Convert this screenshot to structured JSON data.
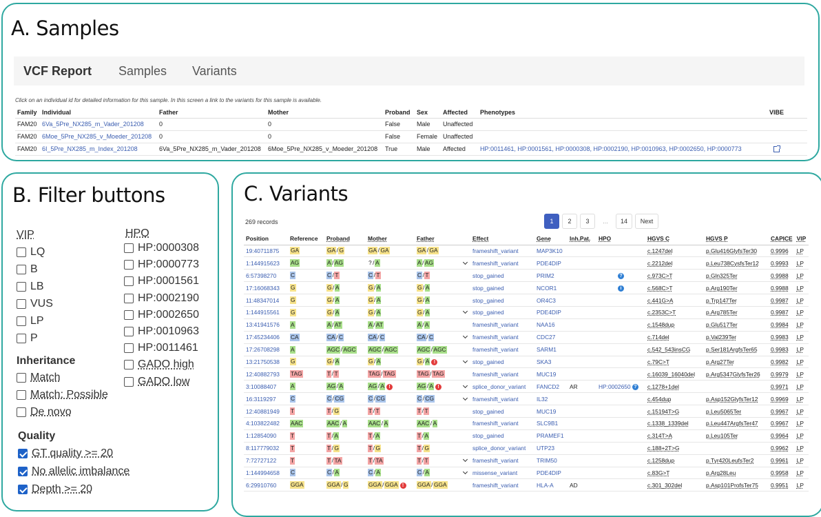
{
  "panels": {
    "a_title": "A.  Samples",
    "b_title": "B. Filter buttons",
    "c_title": "C. Variants"
  },
  "nav": {
    "brand": "VCF Report",
    "links": [
      "Samples",
      "Variants"
    ]
  },
  "samples": {
    "hint": "Click on an individual id for detailed information for this sample. In this screen a link to the variants for this sample is available.",
    "columns": [
      "Family",
      "Individual",
      "Father",
      "Mother",
      "Proband",
      "Sex",
      "Affected",
      "Phenotypes",
      "VIBE"
    ],
    "rows": [
      {
        "family": "FAM20",
        "individual": "6Va_5Pre_NX285_m_Vader_201208",
        "father": "0",
        "mother": "0",
        "proband": "False",
        "sex": "Male",
        "affected": "Unaffected",
        "phenotypes": ""
      },
      {
        "family": "FAM20",
        "individual": "6Moe_5Pre_NX285_v_Moeder_201208",
        "father": "0",
        "mother": "0",
        "proband": "False",
        "sex": "Female",
        "affected": "Unaffected",
        "phenotypes": ""
      },
      {
        "family": "FAM20",
        "individual": "6I_5Pre_NX285_m_Index_201208",
        "father": "6Va_5Pre_NX285_m_Vader_201208",
        "mother": "6Moe_5Pre_NX285_v_Moeder_201208",
        "proband": "True",
        "sex": "Male",
        "affected": "Affected",
        "phenotypes": "HP:0011461, HP:0001561, HP:0000308, HP:0002190, HP:0010963, HP:0002650, HP:0000773"
      }
    ]
  },
  "filters": {
    "vip_label": "VIP",
    "vip": [
      "LQ",
      "B",
      "LB",
      "VUS",
      "LP",
      "P"
    ],
    "hpo_label": "HPO",
    "hpo": [
      "HP:0000308",
      "HP:0000773",
      "HP:0001561",
      "HP:0002190",
      "HP:0002650",
      "HP:0010963",
      "HP:0011461",
      "GADO high",
      "GADO low"
    ],
    "inheritance_label": "Inheritance",
    "inheritance": [
      "Match",
      "Match: Possible",
      "De novo"
    ],
    "quality_label": "Quality",
    "quality": [
      "GT quality >= 20",
      "No allelic imbalance",
      "Depth >= 20"
    ]
  },
  "variants": {
    "records": "269 records",
    "pages": [
      "1",
      "2",
      "3",
      "...",
      "14",
      "Next"
    ],
    "columns": [
      "Position",
      "Reference",
      "Proband",
      "Mother",
      "Father",
      "",
      "Effect",
      "Gene",
      "Inh.Pat.",
      "HPO",
      "HGVS C",
      "HGVS P",
      "CAPICE",
      "VIP"
    ],
    "rows": [
      {
        "pos": "19:40711875",
        "ref": "GA",
        "pro": "GA/G",
        "mot": "GA/GA",
        "fat": "GA/GA",
        "eff": "frameshift_variant",
        "gene": "MAP3K10",
        "inh": "",
        "hpo": "",
        "c": "c.1247del",
        "p": "p.Glu416GlyfsTer30",
        "cap": "0.9996",
        "vip": "LP"
      },
      {
        "pos": "1:144915623",
        "ref": "AG",
        "pro": "A/AG",
        "mot": "?/A",
        "fat": "A/AG",
        "chev": true,
        "eff": "frameshift_variant",
        "gene": "PDE4DIP",
        "inh": "",
        "hpo": "",
        "c": "c.2212del",
        "p": "p.Leu738CysfsTer12",
        "cap": "0.9993",
        "vip": "LP"
      },
      {
        "pos": "6:57398270",
        "ref": "C",
        "pro": "C/T",
        "mot": "C/T",
        "fat": "C/T",
        "eff": "stop_gained",
        "gene": "PRIM2",
        "inh": "",
        "hpo": "?",
        "c": "c.973C>T",
        "p": "p.Gln325Ter",
        "cap": "0.9988",
        "vip": "LP"
      },
      {
        "pos": "17:16068343",
        "ref": "G",
        "pro": "G/A",
        "mot": "G/A",
        "fat": "G/A",
        "eff": "stop_gained",
        "gene": "NCOR1",
        "inh": "",
        "hpo": "i",
        "c": "c.568C>T",
        "p": "p.Arg190Ter",
        "cap": "0.9988",
        "vip": "LP"
      },
      {
        "pos": "11:48347014",
        "ref": "G",
        "pro": "G/A",
        "mot": "G/A",
        "fat": "G/A",
        "eff": "stop_gained",
        "gene": "OR4C3",
        "inh": "",
        "hpo": "",
        "c": "c.441G>A",
        "p": "p.Trp147Ter",
        "cap": "0.9987",
        "vip": "LP"
      },
      {
        "pos": "1:144915561",
        "ref": "G",
        "pro": "G/A",
        "mot": "G/A",
        "fat": "G/A",
        "chev": true,
        "eff": "stop_gained",
        "gene": "PDE4DIP",
        "inh": "",
        "hpo": "",
        "c": "c.2353C>T",
        "p": "p.Arg785Ter",
        "cap": "0.9987",
        "vip": "LP"
      },
      {
        "pos": "13:41941576",
        "ref": "A",
        "pro": "A/AT",
        "mot": "A/AT",
        "fat": "A/A",
        "eff": "frameshift_variant",
        "gene": "NAA16",
        "inh": "",
        "hpo": "",
        "c": "c.1548dup",
        "p": "p.Glu517Ter",
        "cap": "0.9984",
        "vip": "LP"
      },
      {
        "pos": "17:45234406",
        "ref": "CA",
        "pro": "CA/C",
        "mot": "CA/C",
        "fat": "CA/C",
        "chev": true,
        "eff": "frameshift_variant",
        "gene": "CDC27",
        "inh": "",
        "hpo": "",
        "c": "c.714del",
        "p": "p.Val239Ter",
        "cap": "0.9983",
        "vip": "LP"
      },
      {
        "pos": "17:26708298",
        "ref": "A",
        "pro": "AGC/AGC",
        "mot": "AGC/AGC",
        "fat": "AGC/AGC",
        "eff": "frameshift_variant",
        "gene": "SARM1",
        "inh": "",
        "hpo": "",
        "c": "c.542_543insCG",
        "p": "p.Ser181ArgfsTer65",
        "cap": "0.9983",
        "vip": "LP"
      },
      {
        "pos": "13:21750538",
        "ref": "G",
        "pro": "G/A",
        "mot": "G/A",
        "fat": "G/A",
        "fatX": true,
        "chev": true,
        "eff": "stop_gained",
        "gene": "SKA3",
        "inh": "",
        "hpo": "",
        "c": "c.79C>T",
        "p": "p.Arg27Ter",
        "cap": "0.9982",
        "vip": "LP"
      },
      {
        "pos": "12:40882793",
        "ref": "TAG",
        "pro": "T/T",
        "mot": "TAG/TAG",
        "fat": "TAG/TAG",
        "eff": "frameshift_variant",
        "gene": "MUC19",
        "inh": "",
        "hpo": "",
        "c": "c.16039_16040del",
        "p": "p.Arg5347GlyfsTer26",
        "cap": "0.9979",
        "vip": "LP"
      },
      {
        "pos": "3:10088407",
        "ref": "A",
        "pro": "AG/A",
        "mot": "AG/A",
        "motX": true,
        "fat": "AG/A",
        "fatX": true,
        "chev": true,
        "eff": "splice_donor_variant",
        "gene": "FANCD2",
        "inh": "AR",
        "hpo": "HP:0002650",
        "hpoInfo": "?",
        "c": "c.1278+1del",
        "p": "",
        "cap": "0.9971",
        "vip": "LP"
      },
      {
        "pos": "16:3119297",
        "ref": "C",
        "pro": "C/CG",
        "mot": "C/CG",
        "fat": "C/CG",
        "chev": true,
        "eff": "frameshift_variant",
        "gene": "IL32",
        "inh": "",
        "hpo": "",
        "c": "c.454dup",
        "p": "p.Asp152GlyfsTer12",
        "cap": "0.9969",
        "vip": "LP"
      },
      {
        "pos": "12:40881949",
        "ref": "T",
        "pro": "T/G",
        "mot": "T/T",
        "fat": "T/T",
        "eff": "stop_gained",
        "gene": "MUC19",
        "inh": "",
        "hpo": "",
        "c": "c.15194T>G",
        "p": "p.Leu5065Ter",
        "cap": "0.9967",
        "vip": "LP"
      },
      {
        "pos": "4:103822482",
        "ref": "AAC",
        "pro": "AAC/A",
        "mot": "AAC/A",
        "fat": "AAC/A",
        "eff": "frameshift_variant",
        "gene": "SLC9B1",
        "inh": "",
        "hpo": "",
        "c": "c.1338_1339del",
        "p": "p.Leu447ArgfsTer47",
        "cap": "0.9967",
        "vip": "LP"
      },
      {
        "pos": "1:12854090",
        "ref": "T",
        "pro": "T/A",
        "mot": "T/A",
        "fat": "T/A",
        "eff": "stop_gained",
        "gene": "PRAMEF1",
        "inh": "",
        "hpo": "",
        "c": "c.314T>A",
        "p": "p.Leu105Ter",
        "cap": "0.9964",
        "vip": "LP"
      },
      {
        "pos": "8:117779032",
        "ref": "T",
        "pro": "T/G",
        "mot": "T/G",
        "fat": "T/G",
        "eff": "splice_donor_variant",
        "gene": "UTP23",
        "inh": "",
        "hpo": "",
        "c": "c.188+2T>G",
        "p": "",
        "cap": "0.9962",
        "vip": "LP"
      },
      {
        "pos": "7:72727122",
        "ref": "T",
        "pro": "T/TA",
        "mot": "T/TA",
        "fat": "T/T",
        "chev": true,
        "eff": "frameshift_variant",
        "gene": "TRIM50",
        "inh": "",
        "hpo": "",
        "c": "c.1258dup",
        "p": "p.Tyr420LeufsTer2",
        "cap": "0.9961",
        "vip": "LP"
      },
      {
        "pos": "1:144994658",
        "ref": "C",
        "pro": "C/A",
        "mot": "C/A",
        "fat": "C/A",
        "chev": true,
        "eff": "missense_variant",
        "gene": "PDE4DIP",
        "inh": "",
        "hpo": "",
        "c": "c.83G>T",
        "p": "p.Arg28Leu",
        "cap": "0.9958",
        "vip": "LP"
      },
      {
        "pos": "6:29910760",
        "ref": "GGA",
        "pro": "GGA/G",
        "mot": "GGA/GGA",
        "motX": true,
        "fat": "GGA/GGA",
        "eff": "frameshift_variant",
        "gene": "HLA-A",
        "inh": "AD",
        "hpo": "",
        "c": "c.301_302del",
        "p": "p.Asp101ProfsTer75",
        "cap": "0.9951",
        "vip": "LP"
      }
    ]
  }
}
